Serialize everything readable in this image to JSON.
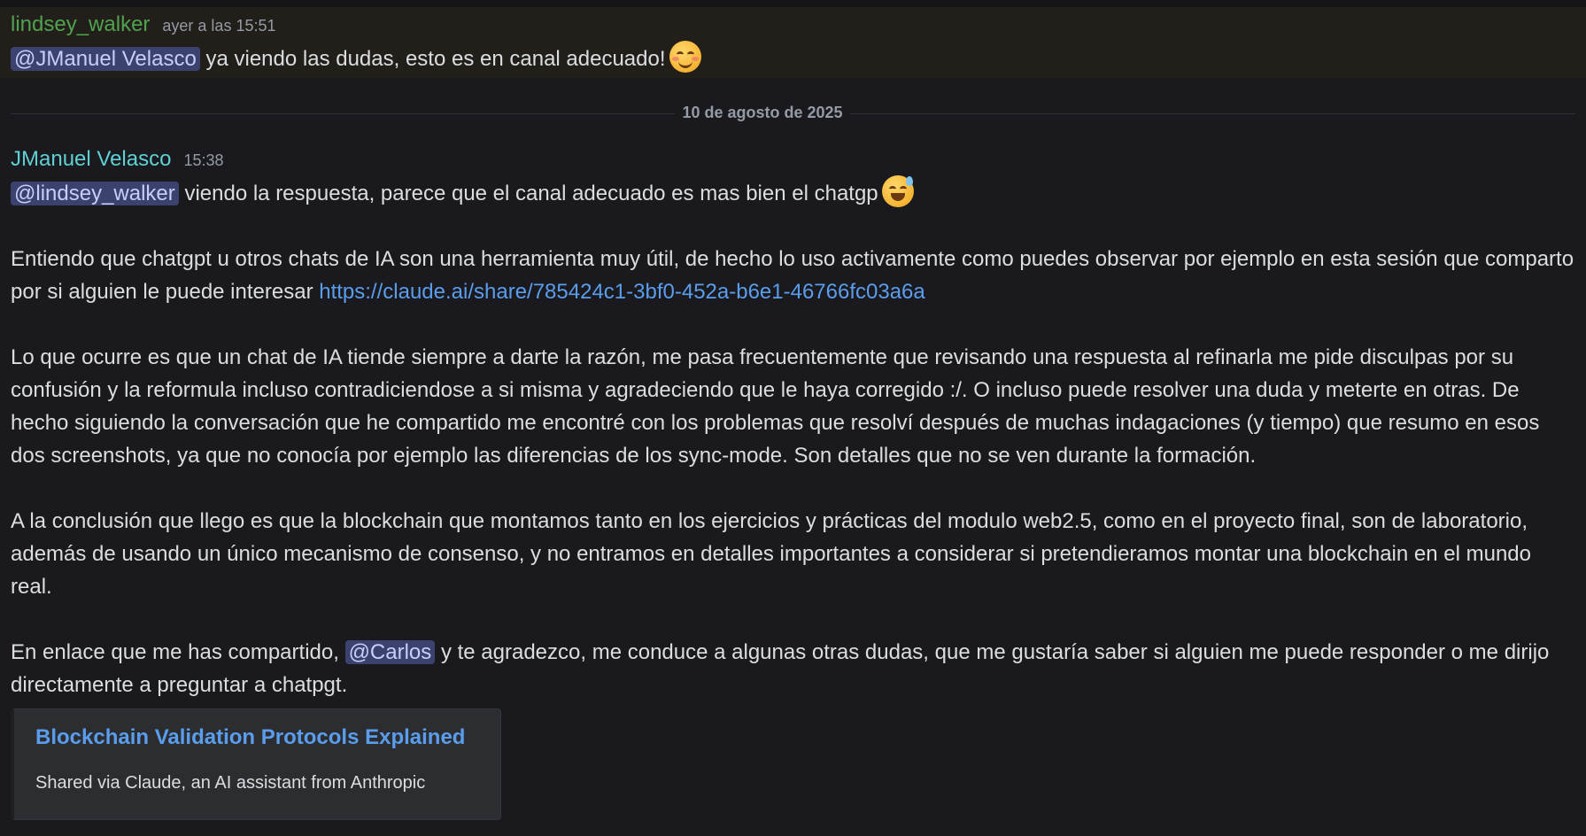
{
  "messages": [
    {
      "author": "lindsey_walker",
      "timestamp": "ayer a las 15:51",
      "mention": "@JManuel Velasco",
      "text": " ya viendo las dudas, esto es en canal adecuado!",
      "emoji": "smiling-face-with-smiling-eyes"
    },
    {
      "author": "JManuel Velasco",
      "timestamp": "15:38",
      "p1_mention": "@lindsey_walker",
      "p1_text": " viendo la respuesta, parece que el canal adecuado es mas bien el chatgp",
      "p1_emoji": "grinning-face-with-sweat",
      "p2_text": "Entiendo que chatgpt u otros chats de IA son una herramienta muy útil, de hecho lo uso activamente como puedes observar por ejemplo en esta sesión que comparto por si alguien le puede interesar ",
      "p2_link": "https://claude.ai/share/785424c1-3bf0-452a-b6e1-46766fc03a6a",
      "p3_text": "Lo que ocurre es que un chat de IA tiende siempre a darte la razón, me pasa frecuentemente que revisando una respuesta al refinarla me pide disculpas por su confusión y la reformula incluso contradiciendose a si misma y agradeciendo que le haya corregido :/. O incluso puede resolver una duda y meterte en otras. De hecho siguiendo la conversación que he compartido me encontré con los problemas que resolví después de muchas indagaciones (y tiempo) que resumo en esos dos screenshots, ya que no conocía por ejemplo las diferencias de los sync-mode. Son detalles que no se ven durante la formación.",
      "p4_text": "A la conclusión que llego es que la blockchain que montamos tanto en los ejercicios y prácticas del modulo web2.5, como en el proyecto final, son de laboratorio, además de usando un único mecanismo de consenso, y no entramos en detalles importantes a considerar si pretendieramos montar una blockchain en el mundo real.",
      "p5_text_a": "En enlace que me has compartido, ",
      "p5_mention": "@Carlos",
      "p5_text_b": " y te agradezco, me conduce a algunas otras dudas, que me gustaría saber si alguien me puede responder o me dirijo directamente a preguntar a chatpgt."
    }
  ],
  "date_divider": "10 de agosto de 2025",
  "embed": {
    "title": "Blockchain Validation Protocols Explained",
    "description": "Shared via Claude, an AI assistant from Anthropic"
  },
  "colors": {
    "author1": "#4fa24f",
    "author2": "#5fd0d4",
    "link": "#5b9ded",
    "mention_bg": "#3c4270"
  }
}
